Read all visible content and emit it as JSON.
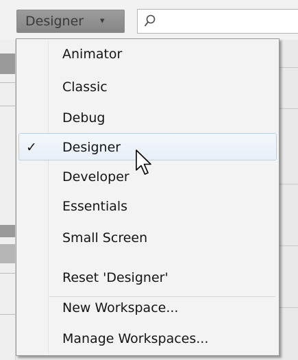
{
  "toolbar": {
    "workspace_button_label": "Designer",
    "workspace_button_caret": "▾",
    "search": {
      "value": "",
      "icon": "search-icon"
    }
  },
  "menu": {
    "items": [
      {
        "label": "Animator",
        "checked": false
      },
      {
        "label": "Classic",
        "checked": false
      },
      {
        "label": "Debug",
        "checked": false
      },
      {
        "label": "Designer",
        "checked": true,
        "highlighted": true
      },
      {
        "label": "Developer",
        "checked": false
      },
      {
        "label": "Essentials",
        "checked": false
      },
      {
        "label": "Small Screen",
        "checked": false
      },
      {
        "label": "Reset 'Designer'",
        "checked": false
      },
      {
        "label": "New Workspace...",
        "checked": false
      },
      {
        "label": "Manage Workspaces...",
        "checked": false
      }
    ],
    "check_glyph": "✓"
  },
  "colors": {
    "menu_background": "#f3f3f3",
    "highlight_border": "#b8d1ea",
    "button_background": "#8f8f8f"
  },
  "cursor": "arrow-pointer-icon"
}
